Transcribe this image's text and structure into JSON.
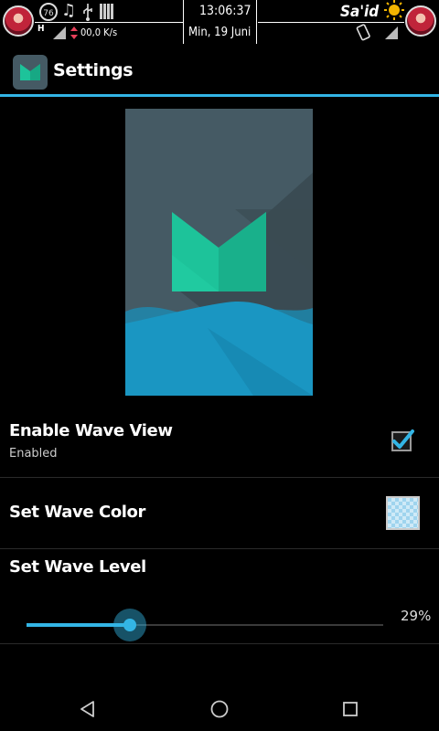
{
  "status_bar": {
    "time": "13:06:37",
    "date": "Min, 19 Juni",
    "carrier_name": "Sa'id",
    "network_speed": "00,0 K/s",
    "network_type": "H",
    "battery_percent": "76",
    "icons": [
      "avatar",
      "battery-circle-icon",
      "music-note-icon",
      "usb-icon",
      "signal-bars-icon",
      "network-type-icon",
      "data-arrows-icon",
      "sun-icon",
      "phone-vibrate-icon"
    ]
  },
  "toolbar": {
    "title": "Settings",
    "accent_color": "#33b5e5",
    "icon": "app-m-logo-icon"
  },
  "preview": {
    "background_color": "#455a64",
    "logo_color": "#1dc39a",
    "wave_color": "#1a96c2"
  },
  "preferences": {
    "wave_view": {
      "title": "Enable Wave View",
      "summary": "Enabled",
      "checked": true
    },
    "wave_color": {
      "title": "Set Wave Color"
    },
    "wave_level": {
      "title": "Set Wave Level",
      "value_label": "29%",
      "value": 0.29
    }
  },
  "navigation": {
    "back": "back-icon",
    "home": "home-icon",
    "recents": "recents-icon"
  }
}
